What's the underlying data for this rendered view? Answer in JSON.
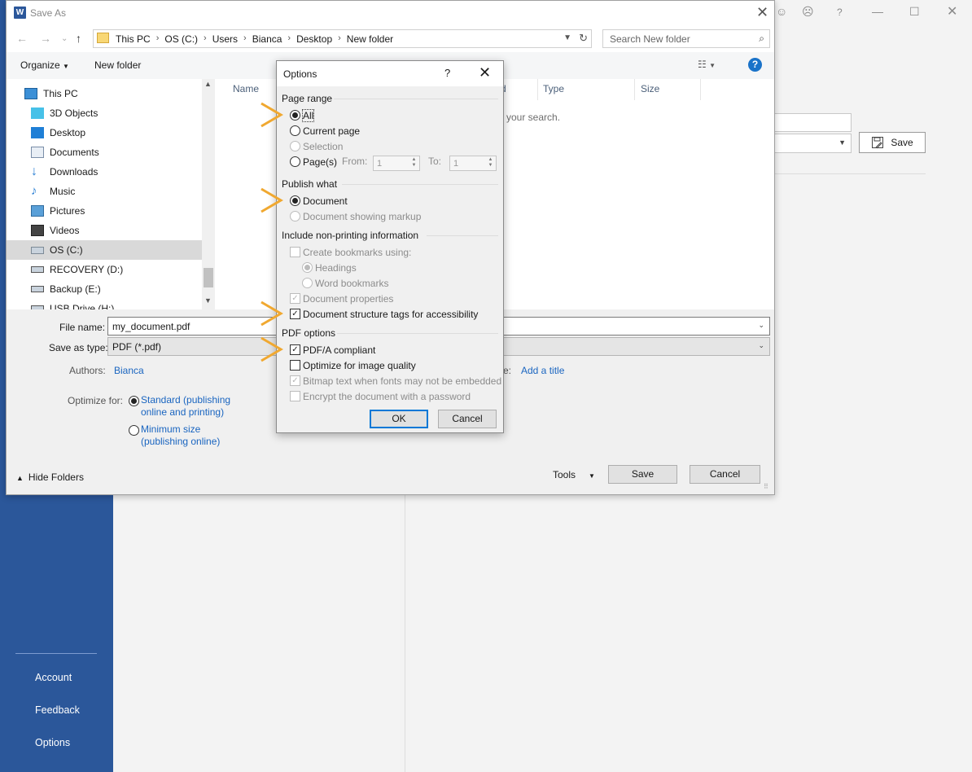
{
  "backstage": {
    "nav": [
      {
        "label": "Account"
      },
      {
        "label": "Feedback"
      },
      {
        "label": "Options"
      }
    ],
    "save_label": "Save"
  },
  "saveas": {
    "title": "Save As",
    "word_icon_letter": "W",
    "breadcrumb": [
      "This PC",
      "OS (C:)",
      "Users",
      "Bianca",
      "Desktop",
      "New folder"
    ],
    "search_placeholder": "Search New folder",
    "toolbar": {
      "organize": "Organize",
      "new_folder": "New folder"
    },
    "nav_items": [
      {
        "label": "This PC",
        "icon": "pc-icon"
      },
      {
        "label": "3D Objects",
        "icon": "3d-objects-icon"
      },
      {
        "label": "Desktop",
        "icon": "desktop-icon"
      },
      {
        "label": "Documents",
        "icon": "documents-icon"
      },
      {
        "label": "Downloads",
        "icon": "downloads-icon"
      },
      {
        "label": "Music",
        "icon": "music-icon"
      },
      {
        "label": "Pictures",
        "icon": "pictures-icon"
      },
      {
        "label": "Videos",
        "icon": "videos-icon"
      },
      {
        "label": "OS (C:)",
        "icon": "drive-icon",
        "selected": true
      },
      {
        "label": "RECOVERY (D:)",
        "icon": "drive-icon"
      },
      {
        "label": "Backup (E:)",
        "icon": "drive-icon"
      },
      {
        "label": "USB Drive (H:)",
        "icon": "drive-icon"
      }
    ],
    "columns": [
      "Name",
      "d",
      "Type",
      "Size"
    ],
    "empty_message": "your search.",
    "file_name_label": "File name:",
    "file_name_value": "my_document.pdf",
    "save_as_type_label": "Save as type:",
    "save_as_type_value": "PDF (*.pdf)",
    "authors_label": "Authors:",
    "authors_value": "Bianca",
    "title_field_label": "e:",
    "title_field_value": "Add a title",
    "optimize_label": "Optimize for:",
    "optimize_standard": [
      "Standard (publishing",
      "online and printing)"
    ],
    "optimize_minimum": [
      "Minimum size",
      "(publishing online)"
    ],
    "hide_folders": "Hide Folders",
    "tools": "Tools",
    "save": "Save",
    "cancel": "Cancel"
  },
  "options": {
    "title": "Options",
    "help": "?",
    "page_range": {
      "heading": "Page range",
      "all": "All",
      "current_page": "Current page",
      "selection": "Selection",
      "pages": "Page(s)",
      "from_label": "From:",
      "from_value": "1",
      "to_label": "To:",
      "to_value": "1"
    },
    "publish_what": {
      "heading": "Publish what",
      "document": "Document",
      "document_markup": "Document showing markup"
    },
    "non_printing": {
      "heading": "Include non-printing information",
      "create_bookmarks": "Create bookmarks using:",
      "headings": "Headings",
      "word_bookmarks": "Word bookmarks",
      "document_properties": "Document properties",
      "structure_tags": "Document structure tags for accessibility"
    },
    "pdf_options": {
      "heading": "PDF options",
      "pdfa": "PDF/A compliant",
      "optimize_image": "Optimize for image quality",
      "bitmap_text": "Bitmap text when fonts may not be embedded",
      "encrypt": "Encrypt the document with a password"
    },
    "ok": "OK",
    "cancel": "Cancel"
  },
  "colors": {
    "word_blue": "#2b579a",
    "annotation_orange": "#f0a830",
    "link_blue": "#1a65c0"
  }
}
